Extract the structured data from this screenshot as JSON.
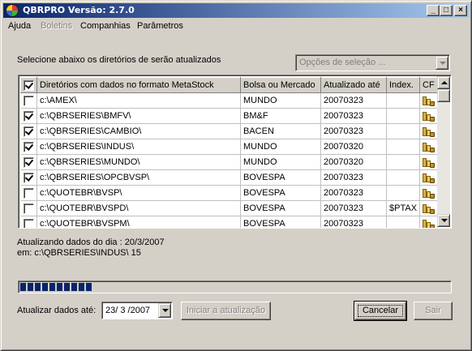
{
  "window": {
    "title": "QBRPRO Versão: 2.7.0"
  },
  "titlebar_buttons": {
    "minimize": "_",
    "maximize": "□",
    "close": "×"
  },
  "menu": [
    {
      "label": "Ajuda",
      "enabled": true
    },
    {
      "label": "Boletins",
      "enabled": false
    },
    {
      "label": "Companhias",
      "enabled": true
    },
    {
      "label": "Parâmetros",
      "enabled": true
    }
  ],
  "instruction": "Selecione abaixo os diretórios de serão atualizados",
  "selection_options": {
    "placeholder": "Opções de seleção ..."
  },
  "grid": {
    "header_checked": true,
    "columns": [
      "Diretórios com dados no formato MetaStock",
      "Bolsa ou Mercado",
      "Atualizado até",
      "Index.",
      "CF"
    ],
    "rows": [
      {
        "checked": false,
        "dir": "c:\\AMEX\\",
        "market": "MUNDO",
        "updated": "20070323",
        "index": ""
      },
      {
        "checked": true,
        "dir": "c:\\QBRSERIES\\BMFV\\",
        "market": "BM&F",
        "updated": "20070323",
        "index": ""
      },
      {
        "checked": true,
        "dir": "c:\\QBRSERIES\\CAMBIO\\",
        "market": "BACEN",
        "updated": "20070323",
        "index": ""
      },
      {
        "checked": true,
        "dir": "c:\\QBRSERIES\\INDUS\\",
        "market": "MUNDO",
        "updated": "20070320",
        "index": ""
      },
      {
        "checked": true,
        "dir": "c:\\QBRSERIES\\MUNDO\\",
        "market": "MUNDO",
        "updated": "20070320",
        "index": ""
      },
      {
        "checked": true,
        "dir": "c:\\QBRSERIES\\OPCBVSP\\",
        "market": "BOVESPA",
        "updated": "20070323",
        "index": ""
      },
      {
        "checked": false,
        "dir": "c:\\QUOTEBR\\BVSP\\",
        "market": "BOVESPA",
        "updated": "20070323",
        "index": ""
      },
      {
        "checked": false,
        "dir": "c:\\QUOTEBR\\BVSPD\\",
        "market": "BOVESPA",
        "updated": "20070323",
        "index": "$PTAX"
      },
      {
        "checked": false,
        "dir": "c:\\QUOTEBR\\BVSPM\\",
        "market": "BOVESPA",
        "updated": "20070323",
        "index": ""
      }
    ]
  },
  "status": {
    "line1": "Atualizando dados do dia : 20/3/2007",
    "line2": "em: c:\\QBRSERIES\\INDUS\\ 15"
  },
  "progress": {
    "fraction": 0.17
  },
  "date_label": "Atualizar dados até:",
  "date_value": "23/ 3 /2007",
  "buttons": {
    "start": "Iniciar a atualização",
    "cancel": "Cancelar",
    "exit": "Sair"
  },
  "colors": {
    "titlebar_start": "#0a246a",
    "titlebar_end": "#a6caf0",
    "progress": "#0a246a"
  }
}
